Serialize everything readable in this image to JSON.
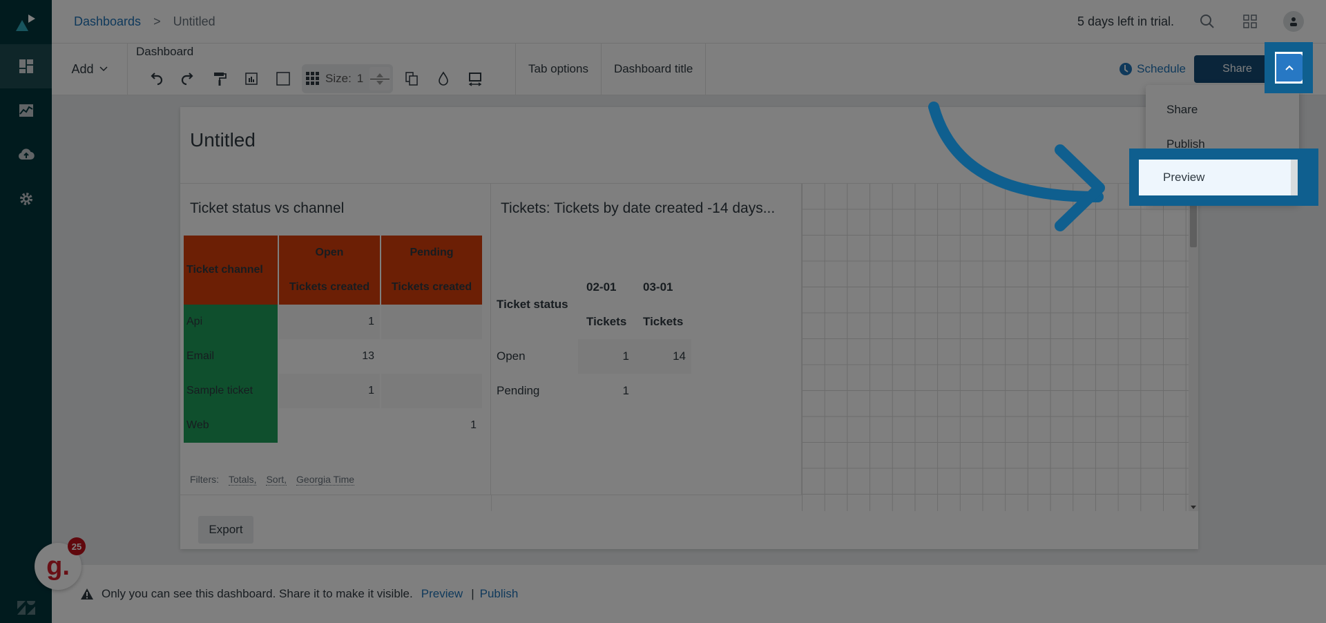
{
  "sidebar": {
    "items": [
      {
        "name": "dashboards",
        "icon": "dashboard-icon",
        "active": true
      },
      {
        "name": "reports",
        "icon": "chart-icon",
        "active": false
      },
      {
        "name": "upload",
        "icon": "cloud-upload-icon",
        "active": false
      },
      {
        "name": "settings",
        "icon": "gear-icon",
        "active": false
      }
    ]
  },
  "topbar": {
    "breadcrumb": {
      "root": "Dashboards",
      "separator": ">",
      "current": "Untitled"
    },
    "trial_text": "5 days left in trial."
  },
  "toolbar": {
    "add_label": "Add",
    "group_label": "Dashboard",
    "size_label": "Size:",
    "size_value": "1",
    "tab_options": "Tab options",
    "dashboard_title": "Dashboard title",
    "schedule_label": "Schedule",
    "share_label": "Share"
  },
  "share_menu": {
    "items": [
      "Share",
      "Publish",
      "Preview"
    ],
    "highlighted": "Preview"
  },
  "dashboard": {
    "title": "Untitled",
    "widgets": [
      {
        "title": "Ticket status vs channel",
        "row_header": "Ticket channel",
        "columns": [
          {
            "status": "Open",
            "metric": "Tickets created"
          },
          {
            "status": "Pending",
            "metric": "Tickets created"
          }
        ],
        "rows": [
          {
            "label": "Api",
            "open": "1",
            "pending": ""
          },
          {
            "label": "Email",
            "open": "13",
            "pending": ""
          },
          {
            "label": "Sample ticket",
            "open": "1",
            "pending": ""
          },
          {
            "label": "Web",
            "open": "",
            "pending": "1"
          }
        ],
        "colors": {
          "header": "#d93f0b",
          "row_header": "#1f9e5b"
        },
        "filters_label": "Filters:",
        "filters": [
          "Totals,",
          "Sort,",
          "Georgia Time"
        ]
      },
      {
        "title": "Tickets: Tickets by date  created -14 days...",
        "row_header": "Ticket status",
        "columns": [
          {
            "date": "02-01",
            "metric": "Tickets"
          },
          {
            "date": "03-01",
            "metric": "Tickets"
          }
        ],
        "rows": [
          {
            "label": "Open",
            "c1": "1",
            "c2": "14"
          },
          {
            "label": "Pending",
            "c1": "1",
            "c2": ""
          }
        ]
      }
    ],
    "export_label": "Export"
  },
  "bottombar": {
    "message": "Only you can see this dashboard. Share it to make it visible.",
    "preview_link": "Preview",
    "pipe": "|",
    "publish_link": "Publish"
  },
  "notification": {
    "letter": "g.",
    "count": "25"
  },
  "colors": {
    "accent": "#1f73b7",
    "share_button": "#144a75",
    "highlight": "#0f5f8f",
    "sidebar": "#03363d"
  }
}
